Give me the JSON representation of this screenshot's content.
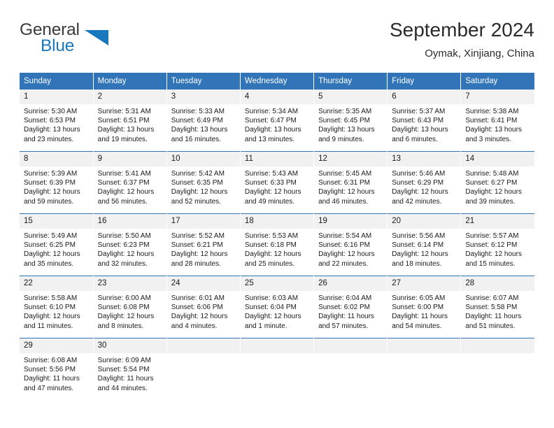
{
  "brand": {
    "line1": "General",
    "line2": "Blue",
    "triangle_icon": "brand-triangle-icon",
    "accent_color": "#1878be"
  },
  "header": {
    "title": "September 2024",
    "subtitle": "Oymak, Xinjiang, China"
  },
  "theme": {
    "header_blue": "#3175b8",
    "daynum_gray": "#f1f1f1",
    "text": "#1a1a1a"
  },
  "columns": [
    "Sunday",
    "Monday",
    "Tuesday",
    "Wednesday",
    "Thursday",
    "Friday",
    "Saturday"
  ],
  "weeks": [
    [
      {
        "day": "1",
        "sunrise": "Sunrise: 5:30 AM",
        "sunset": "Sunset: 6:53 PM",
        "daylight": "Daylight: 13 hours and 23 minutes."
      },
      {
        "day": "2",
        "sunrise": "Sunrise: 5:31 AM",
        "sunset": "Sunset: 6:51 PM",
        "daylight": "Daylight: 13 hours and 19 minutes."
      },
      {
        "day": "3",
        "sunrise": "Sunrise: 5:33 AM",
        "sunset": "Sunset: 6:49 PM",
        "daylight": "Daylight: 13 hours and 16 minutes."
      },
      {
        "day": "4",
        "sunrise": "Sunrise: 5:34 AM",
        "sunset": "Sunset: 6:47 PM",
        "daylight": "Daylight: 13 hours and 13 minutes."
      },
      {
        "day": "5",
        "sunrise": "Sunrise: 5:35 AM",
        "sunset": "Sunset: 6:45 PM",
        "daylight": "Daylight: 13 hours and 9 minutes."
      },
      {
        "day": "6",
        "sunrise": "Sunrise: 5:37 AM",
        "sunset": "Sunset: 6:43 PM",
        "daylight": "Daylight: 13 hours and 6 minutes."
      },
      {
        "day": "7",
        "sunrise": "Sunrise: 5:38 AM",
        "sunset": "Sunset: 6:41 PM",
        "daylight": "Daylight: 13 hours and 3 minutes."
      }
    ],
    [
      {
        "day": "8",
        "sunrise": "Sunrise: 5:39 AM",
        "sunset": "Sunset: 6:39 PM",
        "daylight": "Daylight: 12 hours and 59 minutes."
      },
      {
        "day": "9",
        "sunrise": "Sunrise: 5:41 AM",
        "sunset": "Sunset: 6:37 PM",
        "daylight": "Daylight: 12 hours and 56 minutes."
      },
      {
        "day": "10",
        "sunrise": "Sunrise: 5:42 AM",
        "sunset": "Sunset: 6:35 PM",
        "daylight": "Daylight: 12 hours and 52 minutes."
      },
      {
        "day": "11",
        "sunrise": "Sunrise: 5:43 AM",
        "sunset": "Sunset: 6:33 PM",
        "daylight": "Daylight: 12 hours and 49 minutes."
      },
      {
        "day": "12",
        "sunrise": "Sunrise: 5:45 AM",
        "sunset": "Sunset: 6:31 PM",
        "daylight": "Daylight: 12 hours and 46 minutes."
      },
      {
        "day": "13",
        "sunrise": "Sunrise: 5:46 AM",
        "sunset": "Sunset: 6:29 PM",
        "daylight": "Daylight: 12 hours and 42 minutes."
      },
      {
        "day": "14",
        "sunrise": "Sunrise: 5:48 AM",
        "sunset": "Sunset: 6:27 PM",
        "daylight": "Daylight: 12 hours and 39 minutes."
      }
    ],
    [
      {
        "day": "15",
        "sunrise": "Sunrise: 5:49 AM",
        "sunset": "Sunset: 6:25 PM",
        "daylight": "Daylight: 12 hours and 35 minutes."
      },
      {
        "day": "16",
        "sunrise": "Sunrise: 5:50 AM",
        "sunset": "Sunset: 6:23 PM",
        "daylight": "Daylight: 12 hours and 32 minutes."
      },
      {
        "day": "17",
        "sunrise": "Sunrise: 5:52 AM",
        "sunset": "Sunset: 6:21 PM",
        "daylight": "Daylight: 12 hours and 28 minutes."
      },
      {
        "day": "18",
        "sunrise": "Sunrise: 5:53 AM",
        "sunset": "Sunset: 6:18 PM",
        "daylight": "Daylight: 12 hours and 25 minutes."
      },
      {
        "day": "19",
        "sunrise": "Sunrise: 5:54 AM",
        "sunset": "Sunset: 6:16 PM",
        "daylight": "Daylight: 12 hours and 22 minutes."
      },
      {
        "day": "20",
        "sunrise": "Sunrise: 5:56 AM",
        "sunset": "Sunset: 6:14 PM",
        "daylight": "Daylight: 12 hours and 18 minutes."
      },
      {
        "day": "21",
        "sunrise": "Sunrise: 5:57 AM",
        "sunset": "Sunset: 6:12 PM",
        "daylight": "Daylight: 12 hours and 15 minutes."
      }
    ],
    [
      {
        "day": "22",
        "sunrise": "Sunrise: 5:58 AM",
        "sunset": "Sunset: 6:10 PM",
        "daylight": "Daylight: 12 hours and 11 minutes."
      },
      {
        "day": "23",
        "sunrise": "Sunrise: 6:00 AM",
        "sunset": "Sunset: 6:08 PM",
        "daylight": "Daylight: 12 hours and 8 minutes."
      },
      {
        "day": "24",
        "sunrise": "Sunrise: 6:01 AM",
        "sunset": "Sunset: 6:06 PM",
        "daylight": "Daylight: 12 hours and 4 minutes."
      },
      {
        "day": "25",
        "sunrise": "Sunrise: 6:03 AM",
        "sunset": "Sunset: 6:04 PM",
        "daylight": "Daylight: 12 hours and 1 minute."
      },
      {
        "day": "26",
        "sunrise": "Sunrise: 6:04 AM",
        "sunset": "Sunset: 6:02 PM",
        "daylight": "Daylight: 11 hours and 57 minutes."
      },
      {
        "day": "27",
        "sunrise": "Sunrise: 6:05 AM",
        "sunset": "Sunset: 6:00 PM",
        "daylight": "Daylight: 11 hours and 54 minutes."
      },
      {
        "day": "28",
        "sunrise": "Sunrise: 6:07 AM",
        "sunset": "Sunset: 5:58 PM",
        "daylight": "Daylight: 11 hours and 51 minutes."
      }
    ],
    [
      {
        "day": "29",
        "sunrise": "Sunrise: 6:08 AM",
        "sunset": "Sunset: 5:56 PM",
        "daylight": "Daylight: 11 hours and 47 minutes."
      },
      {
        "day": "30",
        "sunrise": "Sunrise: 6:09 AM",
        "sunset": "Sunset: 5:54 PM",
        "daylight": "Daylight: 11 hours and 44 minutes."
      },
      {
        "day": "",
        "sunrise": "",
        "sunset": "",
        "daylight": ""
      },
      {
        "day": "",
        "sunrise": "",
        "sunset": "",
        "daylight": ""
      },
      {
        "day": "",
        "sunrise": "",
        "sunset": "",
        "daylight": ""
      },
      {
        "day": "",
        "sunrise": "",
        "sunset": "",
        "daylight": ""
      },
      {
        "day": "",
        "sunrise": "",
        "sunset": "",
        "daylight": ""
      }
    ]
  ]
}
